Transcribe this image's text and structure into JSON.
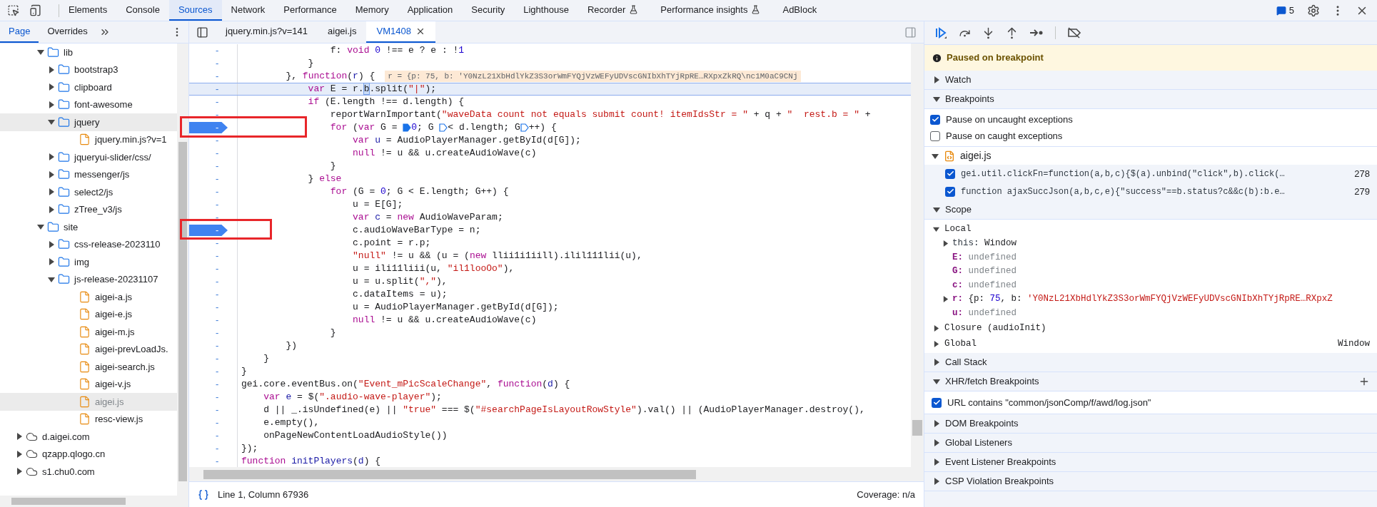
{
  "toolbar": {
    "tabs": [
      {
        "label": "Elements",
        "selected": false,
        "experimental": false
      },
      {
        "label": "Console",
        "selected": false,
        "experimental": false
      },
      {
        "label": "Sources",
        "selected": true,
        "experimental": false
      },
      {
        "label": "Network",
        "selected": false,
        "experimental": false
      },
      {
        "label": "Performance",
        "selected": false,
        "experimental": false
      },
      {
        "label": "Memory",
        "selected": false,
        "experimental": false
      },
      {
        "label": "Application",
        "selected": false,
        "experimental": false
      },
      {
        "label": "Security",
        "selected": false,
        "experimental": false
      },
      {
        "label": "Lighthouse",
        "selected": false,
        "experimental": false
      },
      {
        "label": "Recorder",
        "selected": false,
        "experimental": true
      },
      {
        "label": "Performance insights",
        "selected": false,
        "experimental": true
      },
      {
        "label": "AdBlock",
        "selected": false,
        "experimental": false
      }
    ],
    "message_count": "5"
  },
  "navigator": {
    "tabs": [
      {
        "label": "Page",
        "selected": true
      },
      {
        "label": "Overrides",
        "selected": false
      }
    ],
    "tree": [
      {
        "label": "lib",
        "kind": "folder",
        "expanded": true,
        "selected": false,
        "children": [
          {
            "label": "bootstrap3",
            "kind": "folder",
            "expanded": false,
            "selected": false
          },
          {
            "label": "clipboard",
            "kind": "folder",
            "expanded": false,
            "selected": false
          },
          {
            "label": "font-awesome",
            "kind": "folder",
            "expanded": false,
            "selected": false
          },
          {
            "label": "jquery",
            "kind": "folder",
            "expanded": true,
            "selected": true,
            "children": [
              {
                "label": "jquery.min.js?v=1",
                "kind": "file",
                "selected": false
              }
            ]
          },
          {
            "label": "jqueryui-slider/css/",
            "kind": "folder",
            "expanded": false,
            "selected": false
          },
          {
            "label": "messenger/js",
            "kind": "folder",
            "expanded": false,
            "selected": false
          },
          {
            "label": "select2/js",
            "kind": "folder",
            "expanded": false,
            "selected": false
          },
          {
            "label": "zTree_v3/js",
            "kind": "folder",
            "expanded": false,
            "selected": false
          }
        ]
      },
      {
        "label": "site",
        "kind": "folder",
        "expanded": true,
        "selected": false,
        "children": [
          {
            "label": "css-release-2023110",
            "kind": "folder",
            "expanded": false,
            "selected": false
          },
          {
            "label": "img",
            "kind": "folder",
            "expanded": false,
            "selected": false
          },
          {
            "label": "js-release-20231107",
            "kind": "folder",
            "expanded": true,
            "selected": false,
            "children": [
              {
                "label": "aigei-a.js",
                "kind": "file",
                "selected": false
              },
              {
                "label": "aigei-e.js",
                "kind": "file",
                "selected": false
              },
              {
                "label": "aigei-m.js",
                "kind": "file",
                "selected": false
              },
              {
                "label": "aigei-prevLoadJs.",
                "kind": "file",
                "selected": false
              },
              {
                "label": "aigei-search.js",
                "kind": "file",
                "selected": false
              },
              {
                "label": "aigei-v.js",
                "kind": "file",
                "selected": false
              },
              {
                "label": "aigei.js",
                "kind": "file",
                "selected": true
              },
              {
                "label": "resc-view.js",
                "kind": "file",
                "selected": false
              }
            ]
          }
        ]
      },
      {
        "label": "d.aigei.com",
        "kind": "domain",
        "expanded": false,
        "selected": false
      },
      {
        "label": "qzapp.qlogo.cn",
        "kind": "domain",
        "expanded": false,
        "selected": false
      },
      {
        "label": "s1.chu0.com",
        "kind": "domain",
        "expanded": false,
        "selected": false
      }
    ]
  },
  "editor": {
    "tabs": [
      {
        "label": "jquery.min.js?v=141",
        "selected": false
      },
      {
        "label": "aigei.js",
        "selected": false
      },
      {
        "label": "VM1408",
        "selected": true
      }
    ],
    "lines": [
      {
        "gutter": "-",
        "breakpoint": false,
        "current": false,
        "tokens": [
          {
            "text": "                f: ",
            "kind": "plain"
          },
          {
            "text": "void ",
            "kind": "keyword"
          },
          {
            "text": "0",
            "kind": "number"
          },
          {
            "text": " !== e ? e : !",
            "kind": "plain"
          },
          {
            "text": "1",
            "kind": "number"
          }
        ]
      },
      {
        "gutter": "-",
        "breakpoint": false,
        "current": false,
        "tokens": [
          {
            "text": "            }",
            "kind": "plain"
          }
        ]
      },
      {
        "gutter": "-",
        "breakpoint": false,
        "current": false,
        "tokens": [
          {
            "text": "        }, ",
            "kind": "plain"
          },
          {
            "text": "function",
            "kind": "keyword"
          },
          {
            "text": "(",
            "kind": "plain"
          },
          {
            "text": "r",
            "kind": "def"
          },
          {
            "text": ") {",
            "kind": "plain"
          }
        ],
        "inline_value": "r = {p: 75, b: 'Y0NzL21XbHdlYkZ3S3orWmFYQjVzWEFyUDVscGNIbXhTYjRpRE…RXpxZkRQ\\nc1M0aC9CNj"
      },
      {
        "gutter": "-",
        "breakpoint": false,
        "current": true,
        "tokens": [
          {
            "text": "            var",
            "kind": "keyword"
          },
          {
            "text": " E = r.",
            "kind": "plain"
          },
          {
            "text": "b",
            "kind": "selected"
          },
          {
            "text": ".split(",
            "kind": "plain"
          },
          {
            "text": "\"|\"",
            "kind": "string"
          },
          {
            "text": ");",
            "kind": "plain"
          }
        ]
      },
      {
        "gutter": "-",
        "breakpoint": false,
        "current": false,
        "tokens": [
          {
            "text": "            if",
            "kind": "keyword"
          },
          {
            "text": " (E.length !== d.length) {",
            "kind": "plain"
          }
        ]
      },
      {
        "gutter": "-",
        "breakpoint": false,
        "current": false,
        "tokens": [
          {
            "text": "                reportWarnImportant(",
            "kind": "plain"
          },
          {
            "text": "\"waveData count not equals submit count! itemIdsStr = \"",
            "kind": "string"
          },
          {
            "text": " + q + ",
            "kind": "plain"
          },
          {
            "text": "\"  rest.b = \"",
            "kind": "string"
          },
          {
            "text": " +",
            "kind": "plain"
          }
        ]
      },
      {
        "gutter": "-",
        "breakpoint": true,
        "current": false,
        "tokens": [
          {
            "text": "                for",
            "kind": "keyword"
          },
          {
            "text": " (",
            "kind": "plain"
          },
          {
            "text": "var",
            "kind": "keyword"
          },
          {
            "text": " G = ",
            "kind": "plain"
          },
          {
            "kind": "marker",
            "active": true
          },
          {
            "text": "0",
            "kind": "number"
          },
          {
            "text": "; G ",
            "kind": "plain"
          },
          {
            "kind": "marker",
            "active": false
          },
          {
            "text": "< d.length; G",
            "kind": "plain"
          },
          {
            "kind": "marker",
            "active": false
          },
          {
            "text": "++) {",
            "kind": "plain"
          }
        ]
      },
      {
        "gutter": "-",
        "breakpoint": false,
        "current": false,
        "tokens": [
          {
            "text": "                    var ",
            "kind": "keyword"
          },
          {
            "text": "u",
            "kind": "def"
          },
          {
            "text": " = AudioPlayerManager.getById(d[G]);",
            "kind": "plain"
          }
        ]
      },
      {
        "gutter": "-",
        "breakpoint": false,
        "current": false,
        "tokens": [
          {
            "text": "                    null",
            "kind": "keyword"
          },
          {
            "text": " != u && u.createAudioWave(c)",
            "kind": "plain"
          }
        ]
      },
      {
        "gutter": "-",
        "breakpoint": false,
        "current": false,
        "tokens": [
          {
            "text": "                }",
            "kind": "plain"
          }
        ]
      },
      {
        "gutter": "-",
        "breakpoint": false,
        "current": false,
        "tokens": [
          {
            "text": "            } ",
            "kind": "plain"
          },
          {
            "text": "else",
            "kind": "keyword"
          }
        ]
      },
      {
        "gutter": "-",
        "breakpoint": false,
        "current": false,
        "tokens": [
          {
            "text": "                for",
            "kind": "keyword"
          },
          {
            "text": " (G = ",
            "kind": "plain"
          },
          {
            "text": "0",
            "kind": "number"
          },
          {
            "text": "; G < E.length; G++) {",
            "kind": "plain"
          }
        ]
      },
      {
        "gutter": "-",
        "breakpoint": false,
        "current": false,
        "tokens": [
          {
            "text": "                    u = E[G];",
            "kind": "plain"
          }
        ]
      },
      {
        "gutter": "-",
        "breakpoint": false,
        "current": false,
        "tokens": [
          {
            "text": "                    var ",
            "kind": "keyword"
          },
          {
            "text": "c",
            "kind": "def"
          },
          {
            "text": " = ",
            "kind": "plain"
          },
          {
            "text": "new",
            "kind": "keyword"
          },
          {
            "text": " AudioWaveParam;",
            "kind": "plain"
          }
        ]
      },
      {
        "gutter": "-",
        "breakpoint": true,
        "current": false,
        "tokens": [
          {
            "text": "                    c.audioWaveBarType = n;",
            "kind": "plain"
          }
        ]
      },
      {
        "gutter": "-",
        "breakpoint": false,
        "current": false,
        "tokens": [
          {
            "text": "                    c.point = r.p;",
            "kind": "plain"
          }
        ]
      },
      {
        "gutter": "-",
        "breakpoint": false,
        "current": false,
        "tokens": [
          {
            "text": "                    \"null\"",
            "kind": "string"
          },
          {
            "text": " != u && (u = (",
            "kind": "plain"
          },
          {
            "text": "new",
            "kind": "keyword"
          },
          {
            "text": " llii1i1iill).ilil111lii(u),",
            "kind": "plain"
          }
        ]
      },
      {
        "gutter": "-",
        "breakpoint": false,
        "current": false,
        "tokens": [
          {
            "text": "                    u = ili11liii(u, ",
            "kind": "plain"
          },
          {
            "text": "\"il1looOo\"",
            "kind": "string"
          },
          {
            "text": "),",
            "kind": "plain"
          }
        ]
      },
      {
        "gutter": "-",
        "breakpoint": false,
        "current": false,
        "tokens": [
          {
            "text": "                    u = u.split(",
            "kind": "plain"
          },
          {
            "text": "\",\"",
            "kind": "string"
          },
          {
            "text": "),",
            "kind": "plain"
          }
        ]
      },
      {
        "gutter": "-",
        "breakpoint": false,
        "current": false,
        "tokens": [
          {
            "text": "                    c.dataItems = u);",
            "kind": "plain"
          }
        ]
      },
      {
        "gutter": "-",
        "breakpoint": false,
        "current": false,
        "tokens": [
          {
            "text": "                    u = AudioPlayerManager.getById(d[G]);",
            "kind": "plain"
          }
        ]
      },
      {
        "gutter": "-",
        "breakpoint": false,
        "current": false,
        "tokens": [
          {
            "text": "                    null",
            "kind": "keyword"
          },
          {
            "text": " != u && u.createAudioWave(c)",
            "kind": "plain"
          }
        ]
      },
      {
        "gutter": "-",
        "breakpoint": false,
        "current": false,
        "tokens": [
          {
            "text": "                }",
            "kind": "plain"
          }
        ]
      },
      {
        "gutter": "-",
        "breakpoint": false,
        "current": false,
        "tokens": [
          {
            "text": "        })",
            "kind": "plain"
          }
        ]
      },
      {
        "gutter": "-",
        "breakpoint": false,
        "current": false,
        "tokens": [
          {
            "text": "    }",
            "kind": "plain"
          }
        ]
      },
      {
        "gutter": "-",
        "breakpoint": false,
        "current": false,
        "tokens": [
          {
            "text": "}",
            "kind": "plain"
          }
        ]
      },
      {
        "gutter": "-",
        "breakpoint": false,
        "current": false,
        "tokens": [
          {
            "text": "gei.core.eventBus.on(",
            "kind": "plain"
          },
          {
            "text": "\"Event_mPicScaleChange\"",
            "kind": "string"
          },
          {
            "text": ", ",
            "kind": "plain"
          },
          {
            "text": "function",
            "kind": "keyword"
          },
          {
            "text": "(",
            "kind": "plain"
          },
          {
            "text": "d",
            "kind": "def"
          },
          {
            "text": ") {",
            "kind": "plain"
          }
        ]
      },
      {
        "gutter": "-",
        "breakpoint": false,
        "current": false,
        "tokens": [
          {
            "text": "    var ",
            "kind": "keyword"
          },
          {
            "text": "e",
            "kind": "def"
          },
          {
            "text": " = $(",
            "kind": "plain"
          },
          {
            "text": "\".audio-wave-player\"",
            "kind": "string"
          },
          {
            "text": ");",
            "kind": "plain"
          }
        ]
      },
      {
        "gutter": "-",
        "breakpoint": false,
        "current": false,
        "tokens": [
          {
            "text": "    d || _.isUndefined(e) || ",
            "kind": "plain"
          },
          {
            "text": "\"true\"",
            "kind": "string"
          },
          {
            "text": " === $(",
            "kind": "plain"
          },
          {
            "text": "\"#searchPageIsLayoutRowStyle\"",
            "kind": "string"
          },
          {
            "text": ").val() || (AudioPlayerManager.destroy(),",
            "kind": "plain"
          }
        ]
      },
      {
        "gutter": "-",
        "breakpoint": false,
        "current": false,
        "tokens": [
          {
            "text": "    e.empty(),",
            "kind": "plain"
          }
        ]
      },
      {
        "gutter": "-",
        "breakpoint": false,
        "current": false,
        "tokens": [
          {
            "text": "    onPageNewContentLoadAudioStyle())",
            "kind": "plain"
          }
        ]
      },
      {
        "gutter": "-",
        "breakpoint": false,
        "current": false,
        "tokens": [
          {
            "text": "});",
            "kind": "plain"
          }
        ]
      },
      {
        "gutter": "-",
        "breakpoint": false,
        "current": false,
        "tokens": [
          {
            "text": "function ",
            "kind": "keyword"
          },
          {
            "text": "initPlayers",
            "kind": "def"
          },
          {
            "text": "(",
            "kind": "plain"
          },
          {
            "text": "d",
            "kind": "def"
          },
          {
            "text": ") {",
            "kind": "plain"
          }
        ]
      }
    ],
    "status": {
      "position": "Line 1, Column 67936",
      "coverage": "Coverage: n/a"
    }
  },
  "debugger": {
    "paused_message": "Paused on breakpoint",
    "sections": [
      {
        "title": "Watch",
        "kind": "plain",
        "expanded": false
      },
      {
        "title": "Breakpoints",
        "kind": "breakpoints",
        "expanded": true,
        "options": [
          {
            "label": "Pause on uncaught exceptions",
            "checked": true
          },
          {
            "label": "Pause on caught exceptions",
            "checked": false
          }
        ],
        "files": [
          {
            "name": "aigei.js",
            "expanded": true,
            "breakpoints": [
              {
                "code": "gei.util.clickFn=function(a,b,c){$(a).unbind(\"click\",b).click(…",
                "line": "278",
                "checked": true
              },
              {
                "code": "function ajaxSuccJson(a,b,c,e){\"success\"==b.status?c&&c(b):b.e…",
                "line": "279",
                "checked": true
              }
            ]
          }
        ]
      },
      {
        "title": "Scope",
        "kind": "scope",
        "expanded": true,
        "scopes": [
          {
            "name": "Local",
            "expanded": true,
            "variables": [
              {
                "name": "this:",
                "kind": "receiver",
                "expandable": true,
                "value": [
                  {
                    "text": "Window",
                    "kind": "plain"
                  }
                ]
              },
              {
                "name": "E:",
                "kind": "local",
                "expandable": false,
                "value": [
                  {
                    "text": "undefined",
                    "kind": "undefined"
                  }
                ]
              },
              {
                "name": "G:",
                "kind": "local",
                "expandable": false,
                "value": [
                  {
                    "text": "undefined",
                    "kind": "undefined"
                  }
                ]
              },
              {
                "name": "c:",
                "kind": "local",
                "expandable": false,
                "value": [
                  {
                    "text": "undefined",
                    "kind": "undefined"
                  }
                ]
              },
              {
                "name": "r:",
                "kind": "local",
                "expandable": true,
                "value": [
                  {
                    "text": "{p: ",
                    "kind": "plain"
                  },
                  {
                    "text": "75",
                    "kind": "number"
                  },
                  {
                    "text": ", b: ",
                    "kind": "plain"
                  },
                  {
                    "text": "'Y0NzL21XbHdlYkZ3S3orWmFYQjVzWEFyUDVscGNIbXhTYjRpRE…RXpxZ",
                    "kind": "string"
                  }
                ]
              },
              {
                "name": "u:",
                "kind": "local",
                "expandable": false,
                "value": [
                  {
                    "text": "undefined",
                    "kind": "undefined"
                  }
                ]
              }
            ]
          },
          {
            "name": "Closure (audioInit)",
            "expanded": false
          },
          {
            "name": "Global",
            "expanded": false,
            "value": "Window"
          }
        ]
      },
      {
        "title": "Call Stack",
        "kind": "plain",
        "expanded": false
      },
      {
        "title": "XHR/fetch Breakpoints",
        "kind": "xhr",
        "expanded": true,
        "items": [
          {
            "label": "URL contains \"common/jsonComp/f/awd/log.json\"",
            "checked": true
          }
        ]
      },
      {
        "title": "DOM Breakpoints",
        "kind": "plain",
        "expanded": false
      },
      {
        "title": "Global Listeners",
        "kind": "plain",
        "expanded": false
      },
      {
        "title": "Event Listener Breakpoints",
        "kind": "plain",
        "expanded": false
      },
      {
        "title": "CSP Violation Breakpoints",
        "kind": "plain",
        "expanded": false
      }
    ]
  }
}
